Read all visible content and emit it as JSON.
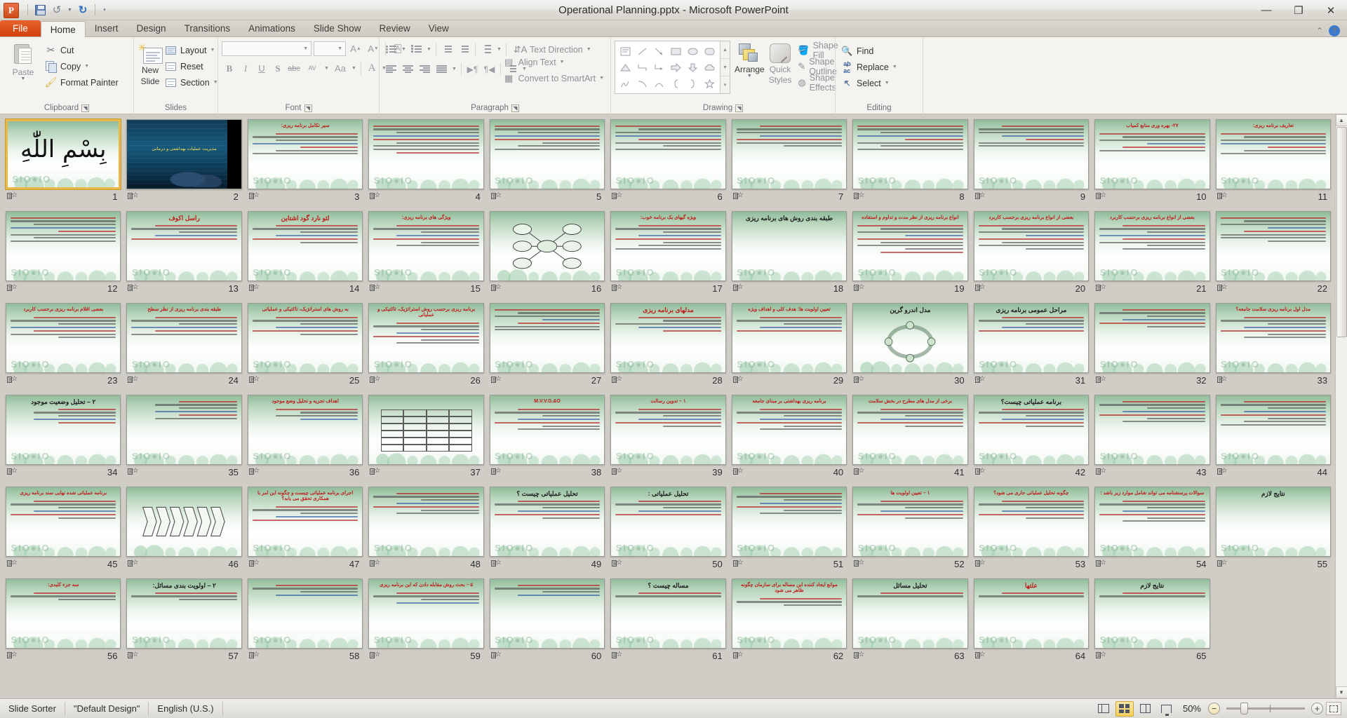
{
  "window": {
    "title": "Operational Planning.pptx  -  Microsoft PowerPoint",
    "minimize": "—",
    "maximize": "❐",
    "close": "✕"
  },
  "quick_access": {
    "save": "save-icon",
    "undo": "↺",
    "redo": "↻",
    "customize": "▾"
  },
  "tabs": [
    {
      "label": "File",
      "active": false,
      "file": true
    },
    {
      "label": "Home",
      "active": true
    },
    {
      "label": "Insert",
      "active": false
    },
    {
      "label": "Design",
      "active": false
    },
    {
      "label": "Transitions",
      "active": false
    },
    {
      "label": "Animations",
      "active": false
    },
    {
      "label": "Slide Show",
      "active": false
    },
    {
      "label": "Review",
      "active": false
    },
    {
      "label": "View",
      "active": false
    }
  ],
  "ribbon": {
    "clipboard": {
      "label": "Clipboard",
      "paste": "Paste",
      "cut": "Cut",
      "copy": "Copy",
      "format_painter": "Format Painter"
    },
    "slides": {
      "label": "Slides",
      "new_slide_l1": "New",
      "new_slide_l2": "Slide",
      "layout": "Layout",
      "reset": "Reset",
      "section": "Section"
    },
    "font": {
      "label": "Font",
      "font_name": "",
      "font_size": "",
      "grow": "A",
      "shrink": "A",
      "clear_formatting": "Aa",
      "bold": "B",
      "italic": "I",
      "underline": "U",
      "shadow": "S",
      "strikethrough": "abc",
      "spacing": "AV",
      "change_case": "Aa",
      "font_color": "A"
    },
    "paragraph": {
      "label": "Paragraph",
      "text_direction": "Text Direction",
      "align_text": "Align Text",
      "convert_smartart": "Convert to SmartArt"
    },
    "drawing": {
      "label": "Drawing",
      "arrange": "Arrange",
      "quick_styles_l1": "Quick",
      "quick_styles_l2": "Styles",
      "shape_fill": "Shape Fill",
      "shape_outline": "Shape Outline",
      "shape_effects": "Shape Effects"
    },
    "editing": {
      "label": "Editing",
      "find": "Find",
      "replace": "Replace",
      "select": "Select"
    }
  },
  "statusbar": {
    "view": "Slide Sorter",
    "theme": "\"Default Design\"",
    "language": "English (U.S.)",
    "zoom": "50%",
    "view_buttons": [
      "normal-view",
      "slide-sorter-view",
      "reading-view",
      "slide-show-view"
    ],
    "fit_to_window": "fit-slide-icon"
  },
  "slides": [
    {
      "n": 1,
      "theme": "calligraphy",
      "selected": true,
      "title": "",
      "lines": []
    },
    {
      "n": 2,
      "theme": "dark",
      "title": "مدیریت عملیات بهداشتی و درمانی",
      "lines": []
    },
    {
      "n": 3,
      "theme": "green",
      "title": "سیر تکامل برنامه ریزی:",
      "title_color": "red",
      "lines": [
        "mid",
        "full",
        "mid",
        "full",
        "short",
        "mid",
        "full"
      ]
    },
    {
      "n": 4,
      "theme": "green",
      "title": "",
      "lines": [
        "full",
        "full",
        "mid",
        "full",
        "full",
        "mid",
        "full",
        "full",
        "mid"
      ]
    },
    {
      "n": 5,
      "theme": "green",
      "title": "",
      "lines": [
        "full",
        "full",
        "mid",
        "full",
        "full",
        "short",
        "mid",
        "full"
      ]
    },
    {
      "n": 6,
      "theme": "green",
      "title": "",
      "lines": [
        "full",
        "mid",
        "full",
        "full",
        "mid",
        "full",
        "short",
        "full"
      ]
    },
    {
      "n": 7,
      "theme": "green",
      "title": "",
      "lines": [
        "mid",
        "full",
        "full",
        "mid",
        "full",
        "full",
        "short"
      ]
    },
    {
      "n": 8,
      "theme": "green",
      "title": "",
      "lines": [
        "full",
        "full",
        "mid",
        "full",
        "short",
        "full",
        "mid",
        "full"
      ]
    },
    {
      "n": 9,
      "theme": "green",
      "title": "",
      "lines": [
        "mid",
        "full",
        "full",
        "mid",
        "short",
        "full",
        "full"
      ]
    },
    {
      "n": 10,
      "theme": "green",
      "title": "۲۷- بهره وری منابع کمیاب",
      "title_color": "red",
      "lines": [
        "full",
        "mid",
        "full",
        "short",
        "mid",
        "full"
      ]
    },
    {
      "n": 11,
      "theme": "green",
      "title": "تعاریف برنامه ریزی:",
      "title_color": "red",
      "lines": [
        "full",
        "mid",
        "full",
        "full",
        "short",
        "mid",
        "full"
      ]
    },
    {
      "n": 12,
      "theme": "green",
      "title": "",
      "lines": [
        "full",
        "full",
        "mid",
        "full",
        "short",
        "full",
        "mid",
        "full"
      ]
    },
    {
      "n": 13,
      "theme": "green",
      "title": "راسل اکوف",
      "title_color": "red",
      "title_big": true,
      "lines": [
        "mid",
        "full",
        "short",
        "mid",
        "full"
      ]
    },
    {
      "n": 14,
      "theme": "green",
      "title": "لئو نارد گود اشتاین",
      "title_color": "red",
      "title_big": true,
      "lines": [
        "mid",
        "full",
        "short",
        "mid",
        "full",
        "short"
      ]
    },
    {
      "n": 15,
      "theme": "green",
      "title": "ویژگی های برنامه ریزی:",
      "title_color": "red",
      "lines": [
        "mid",
        "full",
        "short",
        "mid",
        "full",
        "short",
        "mid"
      ]
    },
    {
      "n": 16,
      "theme": "diagram",
      "title": "",
      "lines": []
    },
    {
      "n": 17,
      "theme": "green",
      "title": "ویژه گیهای یک برنامه خوب:",
      "title_color": "red",
      "lines": [
        "mid",
        "full",
        "short",
        "mid",
        "full",
        "short",
        "mid",
        "full"
      ]
    },
    {
      "n": 18,
      "theme": "green",
      "title": "طبقه بندی روش های برنامه ریزی",
      "title_color": "black",
      "title_big": true,
      "lines": []
    },
    {
      "n": 19,
      "theme": "green",
      "title": "انواع برنامه ریزی از نظر مدت و تداوم و استفاده",
      "title_color": "red",
      "lines": [
        "full",
        "mid",
        "full",
        "short",
        "full",
        "mid",
        "full",
        "short",
        "mid"
      ]
    },
    {
      "n": 20,
      "theme": "green",
      "title": "بعضی از انواع برنامه ریزی برحسب کاربرد",
      "title_color": "red",
      "lines": [
        "full",
        "mid",
        "full",
        "short",
        "full",
        "mid",
        "full",
        "short"
      ]
    },
    {
      "n": 21,
      "theme": "green",
      "title": "بعضی از انواع برنامه ریزی برحسب کاربرد",
      "title_color": "red",
      "lines": [
        "mid",
        "full",
        "short",
        "full",
        "mid",
        "full",
        "short",
        "mid"
      ]
    },
    {
      "n": 22,
      "theme": "green",
      "title": "",
      "lines": [
        "full",
        "mid",
        "full",
        "short",
        "mid",
        "full",
        "full",
        "short"
      ]
    },
    {
      "n": 23,
      "theme": "green",
      "title": "بعضی اقلام برنامه ریزی برحسب کاربرد",
      "title_color": "red",
      "lines": [
        "mid",
        "full",
        "short",
        "full",
        "mid",
        "full",
        "short"
      ]
    },
    {
      "n": 24,
      "theme": "green",
      "title": "طبقه بندی برنامه ریزی از نظر سطح",
      "title_color": "red",
      "lines": [
        "mid",
        "full",
        "short",
        "full",
        "mid",
        "full"
      ]
    },
    {
      "n": 25,
      "theme": "green",
      "title": "به روش های استراتژیک، تاکتیکی و عملیاتی",
      "title_color": "red",
      "lines": [
        "mid",
        "full",
        "short",
        "mid",
        "full",
        "short"
      ]
    },
    {
      "n": 26,
      "theme": "green",
      "title": "برنامه ریزی برحسب روش استراتژیک، تاکتیکی و عملیاتی",
      "title_color": "red",
      "lines": [
        "mid",
        "full",
        "short",
        "mid",
        "full",
        "short",
        "mid"
      ]
    },
    {
      "n": 27,
      "theme": "green",
      "title": "",
      "lines": [
        "full",
        "mid",
        "full",
        "short",
        "mid",
        "full",
        "full"
      ]
    },
    {
      "n": 28,
      "theme": "green",
      "title": "مدلهای برنامه ریزی",
      "title_color": "red",
      "title_big": true,
      "lines": [
        "mid",
        "short",
        "full",
        "mid",
        "short"
      ]
    },
    {
      "n": 29,
      "theme": "green",
      "title": "تعیین اولویت ها: هدف کلی و اهداف ویژه",
      "title_color": "red",
      "lines": [
        "mid",
        "full",
        "short",
        "mid",
        "full"
      ]
    },
    {
      "n": 30,
      "theme": "cycle",
      "title": "مدل اندرو گرین",
      "title_color": "black",
      "title_big": true,
      "lines": []
    },
    {
      "n": 31,
      "theme": "green",
      "title": "مراحل عمومی برنامه ریزی",
      "title_color": "black",
      "title_big": true,
      "lines": [
        "mid",
        "full",
        "short",
        "mid",
        "full"
      ]
    },
    {
      "n": 32,
      "theme": "green",
      "title": "",
      "lines": [
        "mid",
        "full",
        "short",
        "mid",
        "full",
        "short"
      ]
    },
    {
      "n": 33,
      "theme": "green",
      "title": "مدل اول برنامه ریزی سلامت جامعه؟",
      "title_color": "red",
      "lines": [
        "mid",
        "full",
        "short",
        "mid",
        "full",
        "short",
        "mid"
      ]
    },
    {
      "n": 34,
      "theme": "green",
      "title": "۲ – تحلیل وضعیت موجود",
      "title_color": "black",
      "title_big": true,
      "lines": [
        "short",
        "mid",
        "short",
        "mid",
        "short"
      ]
    },
    {
      "n": 35,
      "theme": "green",
      "title": "",
      "lines": [
        "short",
        "mid",
        "short",
        "mid",
        "short",
        "mid"
      ]
    },
    {
      "n": 36,
      "theme": "green",
      "title": "اهداف تجزیه و تحلیل وضع موجود",
      "title_color": "red",
      "lines": [
        "mid",
        "short",
        "mid",
        "short"
      ]
    },
    {
      "n": 37,
      "theme": "table",
      "title": "",
      "lines": []
    },
    {
      "n": 38,
      "theme": "green",
      "title": "M.V.V.G.&O",
      "title_color": "red",
      "lines": [
        "mid",
        "full",
        "short",
        "mid",
        "full",
        "short",
        "mid"
      ]
    },
    {
      "n": 39,
      "theme": "green",
      "title": "۱ – تدوین رسالت",
      "title_color": "red",
      "lines": [
        "mid",
        "full",
        "short",
        "mid",
        "full",
        "short"
      ]
    },
    {
      "n": 40,
      "theme": "green",
      "title": "برنامه ریزی بهداشتی بر مبنای جامعه",
      "title_color": "red",
      "lines": [
        "mid",
        "full",
        "short",
        "mid",
        "full",
        "short",
        "mid"
      ]
    },
    {
      "n": 41,
      "theme": "green",
      "title": "برخی از مدل های مطرح در بخش سلامت",
      "title_color": "red",
      "lines": [
        "mid",
        "full",
        "short",
        "mid",
        "full",
        "short"
      ]
    },
    {
      "n": 42,
      "theme": "green",
      "title": "برنامه عملیاتی چیست؟",
      "title_color": "black",
      "title_big": true,
      "lines": [
        "mid",
        "full",
        "short",
        "mid",
        "full",
        "short"
      ]
    },
    {
      "n": 43,
      "theme": "green",
      "title": "",
      "lines": [
        "mid",
        "full",
        "short",
        "mid",
        "full",
        "short",
        "mid"
      ]
    },
    {
      "n": 44,
      "theme": "green",
      "title": "",
      "lines": [
        "mid",
        "full",
        "short",
        "mid",
        "full",
        "short",
        "mid",
        "full"
      ]
    },
    {
      "n": 45,
      "theme": "green",
      "title": "برنامه عملیاتی شده نهایی سند برنامه ریزی",
      "title_color": "red",
      "lines": [
        "mid",
        "full",
        "short",
        "mid",
        "full",
        "short"
      ]
    },
    {
      "n": 46,
      "theme": "chevron",
      "title": "",
      "lines": []
    },
    {
      "n": 47,
      "theme": "green",
      "title": "اجرای برنامه عملیاتی چیست و چگونه این امر با همکاری تحقق می یابد؟",
      "title_color": "red",
      "lines": [
        "mid",
        "full",
        "short",
        "mid",
        "full"
      ]
    },
    {
      "n": 48,
      "theme": "green",
      "title": "",
      "lines": [
        "mid",
        "full",
        "short",
        "mid",
        "full",
        "short",
        "mid"
      ]
    },
    {
      "n": 49,
      "theme": "green",
      "title": "تحلیل عملیاتی چیست ؟",
      "title_color": "black",
      "title_big": true,
      "lines": [
        "mid",
        "full",
        "short",
        "mid",
        "full",
        "short"
      ]
    },
    {
      "n": 50,
      "theme": "green",
      "title": "تحلیل عملیاتی :",
      "title_color": "black",
      "title_big": true,
      "lines": [
        "mid",
        "full",
        "short",
        "mid",
        "full"
      ]
    },
    {
      "n": 51,
      "theme": "green",
      "title": "",
      "lines": [
        "mid",
        "full",
        "short",
        "mid",
        "full",
        "short",
        "mid"
      ]
    },
    {
      "n": 52,
      "theme": "green",
      "title": "۱ – تعیین اولویت ها",
      "title_color": "red",
      "lines": [
        "mid",
        "full",
        "short",
        "mid",
        "full",
        "short"
      ]
    },
    {
      "n": 53,
      "theme": "green",
      "title": "چگونه تحلیل عملیاتی جاری می شود؟",
      "title_color": "red",
      "lines": [
        "mid",
        "full",
        "short",
        "mid",
        "full",
        "short"
      ]
    },
    {
      "n": 54,
      "theme": "green",
      "title": "سوالات پرسشنامه می تواند شامل موارد زیر باشد :",
      "title_color": "red",
      "lines": [
        "mid",
        "full",
        "short",
        "mid",
        "full",
        "short",
        "mid"
      ]
    },
    {
      "n": 55,
      "theme": "green",
      "title": "نتایج لازم",
      "title_color": "black",
      "title_big": true,
      "lines": []
    },
    {
      "n": 56,
      "theme": "green",
      "title": "سه جزء کلیدی:",
      "title_color": "red",
      "lines": [
        "mid",
        "full",
        "short"
      ]
    },
    {
      "n": 57,
      "theme": "green",
      "title": "۲ – اولویت بندی مسائل:",
      "title_color": "black",
      "title_big": true,
      "lines": [
        "mid",
        "full",
        "short"
      ]
    },
    {
      "n": 58,
      "theme": "green",
      "title": "",
      "lines": [
        "mid",
        "full",
        "short",
        "mid"
      ]
    },
    {
      "n": 59,
      "theme": "green",
      "title": "۵ – بحث روش مقابله دادن که این برنامه ریزی",
      "title_color": "red",
      "lines": [
        "mid",
        "full",
        "short",
        "mid"
      ]
    },
    {
      "n": 60,
      "theme": "green",
      "title": "",
      "lines": [
        "mid",
        "full",
        "short",
        "mid"
      ]
    },
    {
      "n": 61,
      "theme": "green",
      "title": "مساله چیست ؟",
      "title_color": "black",
      "title_big": true,
      "lines": [
        "mid",
        "full"
      ]
    },
    {
      "n": 62,
      "theme": "green",
      "title": "موانع ایجاد کننده این مساله برای سازمان چگونه ظاهر می شود",
      "title_color": "red",
      "lines": [
        "mid",
        "full",
        "short"
      ]
    },
    {
      "n": 63,
      "theme": "green",
      "title": "تحلیل مسائل",
      "title_color": "black",
      "title_big": true,
      "lines": [
        "mid",
        "full"
      ]
    },
    {
      "n": 64,
      "theme": "green",
      "title": "علتها",
      "title_color": "red",
      "title_big": true,
      "lines": [
        "mid",
        "full"
      ]
    },
    {
      "n": 65,
      "theme": "green",
      "title": "نتایج لازم",
      "title_color": "black",
      "title_big": true,
      "lines": [
        "mid",
        "full"
      ]
    }
  ]
}
